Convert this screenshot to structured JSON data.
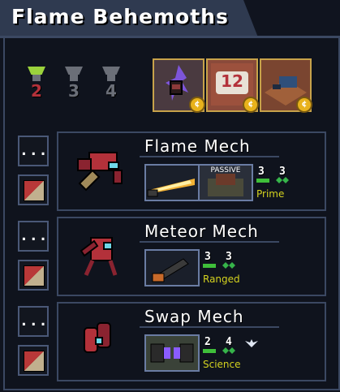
{
  "squad": {
    "title": "Flame Behemoths"
  },
  "ranks": [
    {
      "label": "2",
      "color": "#b3313a",
      "cap": "#9bd23c"
    },
    {
      "label": "3",
      "color": "#6b6f78",
      "cap": "#6b6f78"
    },
    {
      "label": "4",
      "color": "#6b6f78",
      "cap": "#6b6f78"
    }
  ],
  "pilots": [
    {
      "name": "pilot-portal",
      "art": "portal-icon"
    },
    {
      "name": "pilot-number",
      "label": "12",
      "art": "number-tile"
    },
    {
      "name": "pilot-tank",
      "art": "tank-icon"
    }
  ],
  "coin_label": "¢",
  "row_button_label": "...",
  "mechs": [
    {
      "name": "Flame Mech",
      "weapons": [
        "flamethrower-weapon",
        "passive-weapon"
      ],
      "passive_label": "PASSIVE",
      "health": "3",
      "move": "3",
      "class": "Prime",
      "color": "#b3313a"
    },
    {
      "name": "Meteor Mech",
      "weapons": [
        "artillery-weapon"
      ],
      "health": "3",
      "move": "3",
      "class": "Ranged",
      "color": "#b3313a"
    },
    {
      "name": "Swap Mech",
      "weapons": [
        "swap-weapon"
      ],
      "health": "2",
      "move": "4",
      "class": "Science",
      "color": "#b3313a"
    }
  ],
  "colors": {
    "frame": "#3b4862",
    "gold": "#c7a24a",
    "class_text": "#d4d21f",
    "health_green": "#3fbf3a",
    "move_green": "#36b44a"
  }
}
